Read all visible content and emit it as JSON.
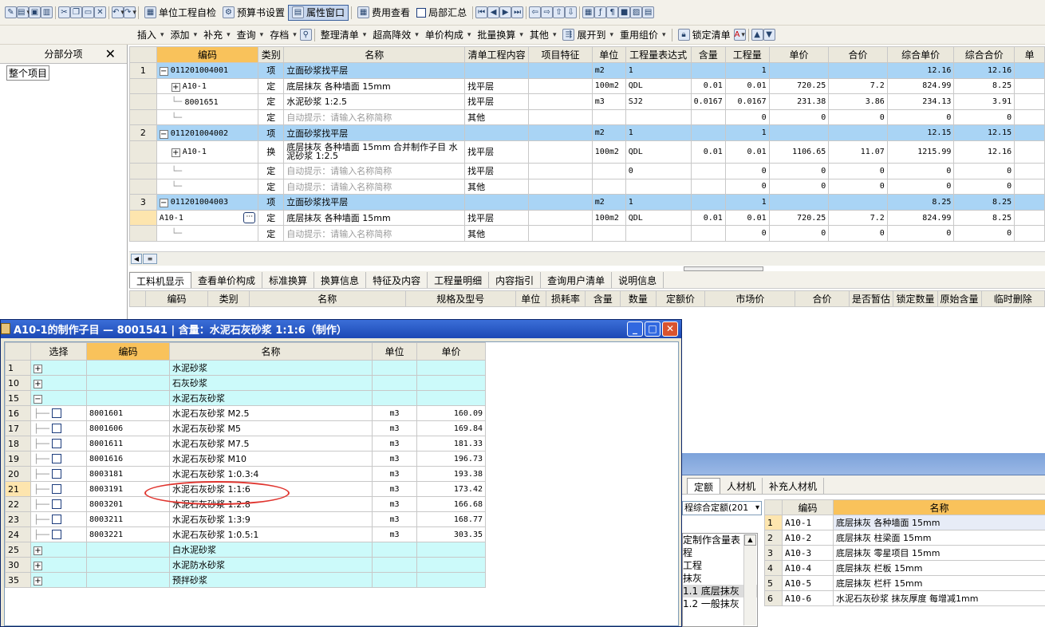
{
  "toolbar1": {
    "items": [
      "单位工程自检",
      "预算书设置",
      "属性窗口",
      "费用查看",
      "局部汇总"
    ]
  },
  "toolbar2": {
    "items": [
      "插入",
      "添加",
      "补充",
      "查询",
      "存档",
      "整理清单",
      "超高降效",
      "单价构成",
      "批量换算",
      "其他",
      "展开到",
      "重用组价",
      "锁定清单"
    ]
  },
  "tree": {
    "title": "分部分项",
    "close": "✕",
    "root": "整个项目"
  },
  "main": {
    "headers": [
      "编码",
      "类别",
      "名称",
      "清单工程内容",
      "项目特征",
      "单位",
      "工程量表达式",
      "含量",
      "工程量",
      "单价",
      "合价",
      "综合单价",
      "综合合价",
      "单"
    ],
    "rows": [
      {
        "no": "1",
        "code": "011201004001",
        "type": "项",
        "name": "立面砂浆找平层",
        "content": "",
        "feat": "",
        "unit": "m2",
        "expr": "1",
        "qty_ratio": "",
        "qty": "1",
        "price": "",
        "total": "",
        "cprice": "12.16",
        "ctotal": "12.16",
        "kind": "q"
      },
      {
        "no": "",
        "code": "A10-1",
        "type": "定",
        "name": "底层抹灰 各种墙面 15mm",
        "content": "找平层",
        "feat": "",
        "unit": "100m2",
        "expr": "QDL",
        "qty_ratio": "0.01",
        "qty": "0.01",
        "price": "720.25",
        "total": "7.2",
        "cprice": "824.99",
        "ctotal": "8.25",
        "kind": "plus"
      },
      {
        "no": "",
        "code": "8001651",
        "type": "定",
        "name": "水泥砂浆 1:2.5",
        "content": "找平层",
        "feat": "",
        "unit": "m3",
        "expr": "SJ2",
        "qty_ratio": "0.0167",
        "qty": "0.0167",
        "price": "231.38",
        "total": "3.86",
        "cprice": "234.13",
        "ctotal": "3.91",
        "kind": "line"
      },
      {
        "no": "",
        "code": "",
        "type": "定",
        "name": "自动提示：请输入名称简称",
        "content": "其他",
        "feat": "",
        "unit": "",
        "expr": "",
        "qty_ratio": "",
        "qty": "0",
        "price": "0",
        "total": "0",
        "cprice": "0",
        "ctotal": "0",
        "kind": "hint"
      },
      {
        "no": "2",
        "code": "011201004002",
        "type": "项",
        "name": "立面砂浆找平层",
        "content": "",
        "feat": "",
        "unit": "m2",
        "expr": "1",
        "qty_ratio": "",
        "qty": "1",
        "price": "",
        "total": "",
        "cprice": "12.15",
        "ctotal": "12.15",
        "kind": "q"
      },
      {
        "no": "",
        "code": "A10-1",
        "type": "换",
        "name": "底层抹灰 各种墙面 15mm 合并制作子目 水泥砂浆 1:2.5",
        "content": "找平层",
        "feat": "",
        "unit": "100m2",
        "expr": "QDL",
        "qty_ratio": "0.01",
        "qty": "0.01",
        "price": "1106.65",
        "total": "11.07",
        "cprice": "1215.99",
        "ctotal": "12.16",
        "kind": "plus2"
      },
      {
        "no": "",
        "code": "",
        "type": "定",
        "name": "自动提示：请输入名称简称",
        "content": "找平层",
        "feat": "",
        "unit": "",
        "expr": "0",
        "qty_ratio": "",
        "qty": "0",
        "price": "0",
        "total": "0",
        "cprice": "0",
        "ctotal": "0",
        "kind": "hint"
      },
      {
        "no": "",
        "code": "",
        "type": "定",
        "name": "自动提示：请输入名称简称",
        "content": "其他",
        "feat": "",
        "unit": "",
        "expr": "",
        "qty_ratio": "",
        "qty": "0",
        "price": "0",
        "total": "0",
        "cprice": "0",
        "ctotal": "0",
        "kind": "hint"
      },
      {
        "no": "3",
        "code": "011201004003",
        "type": "项",
        "name": "立面砂浆找平层",
        "content": "",
        "feat": "",
        "unit": "m2",
        "expr": "1",
        "qty_ratio": "",
        "qty": "1",
        "price": "",
        "total": "",
        "cprice": "8.25",
        "ctotal": "8.25",
        "kind": "q"
      },
      {
        "no": "",
        "code": "A10-1",
        "type": "定",
        "name": "底层抹灰 各种墙面 15mm",
        "content": "找平层",
        "feat": "",
        "unit": "100m2",
        "expr": "QDL",
        "qty_ratio": "0.01",
        "qty": "0.01",
        "price": "720.25",
        "total": "7.2",
        "cprice": "824.99",
        "ctotal": "8.25",
        "kind": "edit"
      },
      {
        "no": "",
        "code": "",
        "type": "定",
        "name": "自动提示：请输入名称简称",
        "content": "其他",
        "feat": "",
        "unit": "",
        "expr": "",
        "qty_ratio": "",
        "qty": "0",
        "price": "0",
        "total": "0",
        "cprice": "0",
        "ctotal": "0",
        "kind": "hint"
      }
    ]
  },
  "bottom_tabs": [
    "工料机显示",
    "查看单价构成",
    "标准换算",
    "换算信息",
    "特征及内容",
    "工程量明细",
    "内容指引",
    "查询用户清单",
    "说明信息"
  ],
  "sub_headers": [
    "编码",
    "类别",
    "名称",
    "规格及型号",
    "单位",
    "损耗率",
    "含量",
    "数量",
    "定额价",
    "市场价",
    "合价",
    "是否暂估",
    "锁定数量",
    "原始含量",
    "临时删除"
  ],
  "dialog": {
    "title": "A10-1的制作子目 — 8001541 | 含量：水泥石灰砂浆 1:1:6（制作）",
    "headers": [
      "选择",
      "编码",
      "名称",
      "单位",
      "单价"
    ],
    "rows": [
      {
        "no": "1",
        "tog": "+",
        "check": false,
        "code": "",
        "name": "水泥砂浆",
        "unit": "",
        "price": "",
        "group": true
      },
      {
        "no": "10",
        "tog": "+",
        "check": false,
        "code": "",
        "name": "石灰砂浆",
        "unit": "",
        "price": "",
        "group": true
      },
      {
        "no": "15",
        "tog": "−",
        "check": false,
        "code": "",
        "name": "水泥石灰砂浆",
        "unit": "",
        "price": "",
        "group": true
      },
      {
        "no": "16",
        "tog": "",
        "check": true,
        "code": "8001601",
        "name": "水泥石灰砂浆 M2.5",
        "unit": "m3",
        "price": "160.09",
        "group": false
      },
      {
        "no": "17",
        "tog": "",
        "check": true,
        "code": "8001606",
        "name": "水泥石灰砂浆 M5",
        "unit": "m3",
        "price": "169.84",
        "group": false
      },
      {
        "no": "18",
        "tog": "",
        "check": true,
        "code": "8001611",
        "name": "水泥石灰砂浆 M7.5",
        "unit": "m3",
        "price": "181.33",
        "group": false
      },
      {
        "no": "19",
        "tog": "",
        "check": true,
        "code": "8001616",
        "name": "水泥石灰砂浆 M10",
        "unit": "m3",
        "price": "196.73",
        "group": false
      },
      {
        "no": "20",
        "tog": "",
        "check": true,
        "code": "8003181",
        "name": "水泥石灰砂浆 1:0.3:4",
        "unit": "m3",
        "price": "193.38",
        "group": false
      },
      {
        "no": "21",
        "tog": "",
        "check": true,
        "code": "8003191",
        "name": "水泥石灰砂浆 1:1:6",
        "unit": "m3",
        "price": "173.42",
        "group": false,
        "current": true
      },
      {
        "no": "22",
        "tog": "",
        "check": true,
        "code": "8003201",
        "name": "水泥石灰砂浆 1:2:8",
        "unit": "m3",
        "price": "166.68",
        "group": false
      },
      {
        "no": "23",
        "tog": "",
        "check": true,
        "code": "8003211",
        "name": "水泥石灰砂浆 1:3:9",
        "unit": "m3",
        "price": "168.77",
        "group": false
      },
      {
        "no": "24",
        "tog": "",
        "check": true,
        "code": "8003221",
        "name": "水泥石灰砂浆 1:0.5:1",
        "unit": "m3",
        "price": "303.35",
        "group": false
      },
      {
        "no": "25",
        "tog": "+",
        "check": false,
        "code": "",
        "name": "白水泥砂浆",
        "unit": "",
        "price": "",
        "group": true
      },
      {
        "no": "30",
        "tog": "+",
        "check": false,
        "code": "",
        "name": "水泥防水砂浆",
        "unit": "",
        "price": "",
        "group": true
      },
      {
        "no": "35",
        "tog": "+",
        "check": false,
        "code": "",
        "name": "预拌砂浆",
        "unit": "",
        "price": "",
        "group": true
      }
    ]
  },
  "right_panel": {
    "tabs": [
      "定额",
      "人材机",
      "补充人材机"
    ],
    "select": "程综合定额(201",
    "tree": [
      "定制作含量表",
      "程",
      "工程",
      "抹灰",
      "1.1 底层抹灰",
      "1.2 一般抹灰"
    ],
    "headers": [
      "编码",
      "名称"
    ],
    "rows": [
      {
        "no": "1",
        "code": "A10-1",
        "name": "底层抹灰 各种墙面 15mm"
      },
      {
        "no": "2",
        "code": "A10-2",
        "name": "底层抹灰 柱梁面 15mm"
      },
      {
        "no": "3",
        "code": "A10-3",
        "name": "底层抹灰 零星项目 15mm"
      },
      {
        "no": "4",
        "code": "A10-4",
        "name": "底层抹灰 栏板 15mm"
      },
      {
        "no": "5",
        "code": "A10-5",
        "name": "底层抹灰 栏杆 15mm"
      },
      {
        "no": "6",
        "code": "A10-6",
        "name": "水泥石灰砂浆 抹灰厚度 每增减1mm"
      }
    ]
  }
}
